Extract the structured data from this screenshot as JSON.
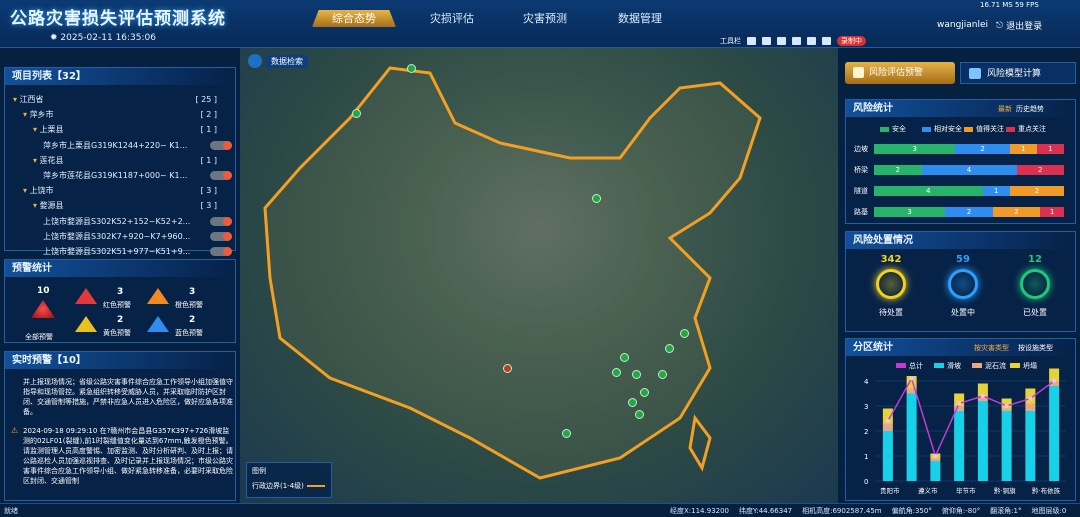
{
  "app": {
    "title": "公路灾害损失评估预测系统",
    "datetime": "2025-02-11 16:35:06",
    "perf": "16.71 MS  59 FPS",
    "user": "wangjianlei",
    "logout": "退出登录"
  },
  "nav": [
    {
      "label": "综合态势",
      "active": true
    },
    {
      "label": "灾损评估",
      "active": false
    },
    {
      "label": "灾害预测",
      "active": false
    },
    {
      "label": "数据管理",
      "active": false
    }
  ],
  "toolbar": {
    "tool_label": "工具栏",
    "record": "录制中"
  },
  "map": {
    "search_label": "数据检索",
    "legend_title": "图例",
    "legend_item": "行政边界(1-4级)"
  },
  "project_list": {
    "title": "项目列表【32】",
    "rows": [
      {
        "label": "江西省",
        "count": "[ 25 ]",
        "level": 0
      },
      {
        "label": "萍乡市",
        "count": "[ 2 ]",
        "level": 1
      },
      {
        "label": "上栗县",
        "count": "[ 1 ]",
        "level": 2
      },
      {
        "label": "萍乡市上栗县G319K1244+220~ K1...",
        "count": "",
        "level": 3,
        "toggle": true
      },
      {
        "label": "莲花县",
        "count": "[ 1 ]",
        "level": 2
      },
      {
        "label": "萍乡市莲花县G319K1187+000~ K1...",
        "count": "",
        "level": 3,
        "toggle": true
      },
      {
        "label": "上饶市",
        "count": "[ 3 ]",
        "level": 1
      },
      {
        "label": "婺源县",
        "count": "[ 3 ]",
        "level": 2
      },
      {
        "label": "上饶市婺源县S302K52+152~K52+2...",
        "count": "",
        "level": 3,
        "toggle": true
      },
      {
        "label": "上饶市婺源县S302K7+920~K7+960...",
        "count": "",
        "level": 3,
        "toggle": true
      },
      {
        "label": "上饶市婺源县S302K51+977~K51+9...",
        "count": "",
        "level": 3,
        "toggle": true
      }
    ]
  },
  "warning_stats": {
    "title": "预警统计",
    "total": {
      "value": "10",
      "label": "全部预警"
    },
    "items": [
      {
        "value": "3",
        "label": "红色预警",
        "color": "#e03a3a"
      },
      {
        "value": "3",
        "label": "橙色预警",
        "color": "#f08a22"
      },
      {
        "value": "2",
        "label": "黄色预警",
        "color": "#e8c21f"
      },
      {
        "value": "2",
        "label": "蓝色预警",
        "color": "#2f8df0"
      }
    ]
  },
  "realtime": {
    "title": "实时预警【10】",
    "text1": "并上报现场情况；省级公路灾害事件综合应急工作领导小组加强值守指导和现场管控。紧急组织转移受威胁人员，并采取临时防护区封闭、交通管制等措施，严禁非应急人员进入危险区，做好应急各项准备。",
    "text2": "2024-09-18 09:29:10 在?赣州市会昌县G357K397+726滑坡监测的02LF01(裂缝),前1时裂缝值变化量达到67mm,触发橙色预警。请监测管理人员高度警惕、加密监测、及时分析研判、及时上报；请公路巡检人员加强巡视排查、及时记录并上报现场情况；市级公路灾害事件综合应急工作领导小组、做好紧急转移准备，必要时采取危险区封闭、交通管制"
  },
  "right_tabs": [
    {
      "label": "风险评估预警",
      "active": true
    },
    {
      "label": "风险模型计算",
      "active": false
    }
  ],
  "risk_stats": {
    "title": "风险统计",
    "links": [
      "最新",
      "历史趋势"
    ],
    "legend": [
      {
        "label": "安全",
        "color": "#27b36a"
      },
      {
        "label": "相对安全",
        "color": "#2f8df0"
      },
      {
        "label": "值得关注",
        "color": "#f09a2a"
      },
      {
        "label": "重点关注",
        "color": "#d9314f"
      }
    ],
    "rows": [
      {
        "label": "边坡",
        "values": [
          3,
          2,
          1,
          1
        ]
      },
      {
        "label": "桥梁",
        "values": [
          2,
          4,
          0,
          2
        ]
      },
      {
        "label": "隧道",
        "values": [
          4,
          1,
          2,
          0
        ]
      },
      {
        "label": "路基",
        "values": [
          3,
          2,
          2,
          1
        ]
      }
    ]
  },
  "risk_handling": {
    "title": "风险处置情况",
    "items": [
      {
        "value": "342",
        "label": "待处置",
        "color": "#f2d21c"
      },
      {
        "value": "59",
        "label": "处置中",
        "color": "#2aa0ff"
      },
      {
        "value": "12",
        "label": "已处置",
        "color": "#21c77a"
      }
    ]
  },
  "district": {
    "title": "分区统计",
    "links": [
      "按灾害类型",
      "按设施类型"
    ]
  },
  "chart_data": {
    "type": "bar",
    "categories": [
      "贵阳市",
      "遵义市",
      "毕节市",
      "黔·铜旗",
      "黔·布依族"
    ],
    "legend": [
      "总计",
      "滑坡",
      "泥石流",
      "坍塌"
    ],
    "ylim": [
      0,
      4
    ],
    "yticks": [
      "0",
      "1",
      "2",
      "3",
      "4"
    ],
    "series": [
      {
        "name": "滑坡",
        "values": [
          2,
          3.5,
          0.8,
          2.8,
          3.2,
          2.8,
          2.8,
          3.8
        ]
      },
      {
        "name": "泥石流",
        "values": [
          0.3,
          0.2,
          0.1,
          0.2,
          0.2,
          0.1,
          0.3,
          0.2
        ]
      },
      {
        "name": "坍塌",
        "values": [
          0.6,
          0.5,
          0.2,
          0.5,
          0.5,
          0.4,
          0.6,
          0.5
        ]
      },
      {
        "name": "总计",
        "values": [
          2.4,
          4.1,
          1,
          3.1,
          3.4,
          3,
          3.3,
          4
        ]
      }
    ]
  },
  "status": {
    "items": [
      "经度X:114.93200",
      "纬度Y:44.66347",
      "相机高度:6902587.45m",
      "偏航角:350°",
      "俯仰角:-80°",
      "翻滚角:1°",
      "地图层级:0"
    ],
    "left": "就绪"
  }
}
